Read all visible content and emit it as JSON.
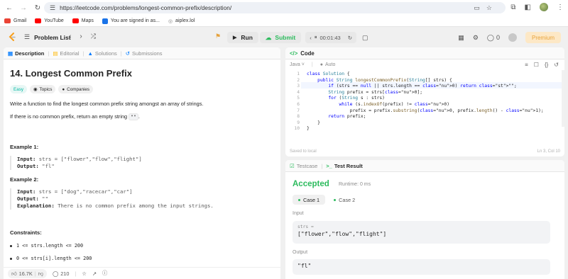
{
  "browser": {
    "url": "https://leetcode.com/problems/longest-common-prefix/description/",
    "bookmarks": [
      {
        "label": "Gmail",
        "color": "#ea4335"
      },
      {
        "label": "YouTube",
        "color": "#ff0000"
      },
      {
        "label": "Maps",
        "color": "#ff0000"
      },
      {
        "label": "You are signed in as...",
        "color": "#1a73e8"
      },
      {
        "label": "aiplex.lol",
        "color": "#9e9e9e"
      }
    ]
  },
  "header": {
    "problem_list": "Problem List",
    "run": "Run",
    "submit": "Submit",
    "timer": "00:01:43",
    "streak_count": "0",
    "premium": "Premium"
  },
  "left_tabs": [
    "Description",
    "Editorial",
    "Solutions",
    "Submissions"
  ],
  "problem": {
    "title": "14. Longest Common Prefix",
    "difficulty": "Easy",
    "topics": "Topics",
    "companies": "Companies",
    "description_1": "Write a function to find the longest common prefix string amongst an array of strings.",
    "description_2_pre": "If there is no common prefix, return an empty string",
    "description_2_code": "\"\"",
    "description_2_post": ".",
    "example1_title": "Example 1:",
    "example1_input_label": "Input:",
    "example1_input": "strs = [\"flower\",\"flow\",\"flight\"]",
    "example1_output_label": "Output:",
    "example1_output": "\"fl\"",
    "example2_title": "Example 2:",
    "example2_input_label": "Input:",
    "example2_input": "strs = [\"dog\",\"racecar\",\"car\"]",
    "example2_output_label": "Output:",
    "example2_output": "\"\"",
    "example2_expl_label": "Explanation:",
    "example2_expl": "There is no common prefix among the input strings.",
    "constraints_title": "Constraints:",
    "constraints": [
      "1 <= strs.length <= 200",
      "0 <= strs[i].length <= 200"
    ],
    "likes": "16.7K",
    "comments": "210"
  },
  "code_panel": {
    "tab": "Code",
    "language": "Java",
    "mode": "Auto",
    "saved": "Saved to local",
    "cursor": "Ln 3, Col 10"
  },
  "code_lines": [
    "class Solution {",
    "    public String longestCommonPrefix(String[] strs) {",
    "        if (strs == null || strs.length == 0) return \"\";",
    "        String prefix = strs[0];",
    "        for (String s : strs)",
    "            while (s.indexOf(prefix) != 0)",
    "                prefix = prefix.substring(0, prefix.length() - 1);",
    "        return prefix;",
    "    }",
    "}"
  ],
  "test_panel": {
    "tab_testcase": "Testcase",
    "tab_result": "Test Result",
    "status": "Accepted",
    "runtime": "Runtime: 0 ms",
    "case1": "Case 1",
    "case2": "Case 2",
    "input_label": "Input",
    "input_var": "strs =",
    "input_value": "[\"flower\",\"flow\",\"flight\"]",
    "output_label": "Output",
    "output_value": "\"fl\""
  }
}
